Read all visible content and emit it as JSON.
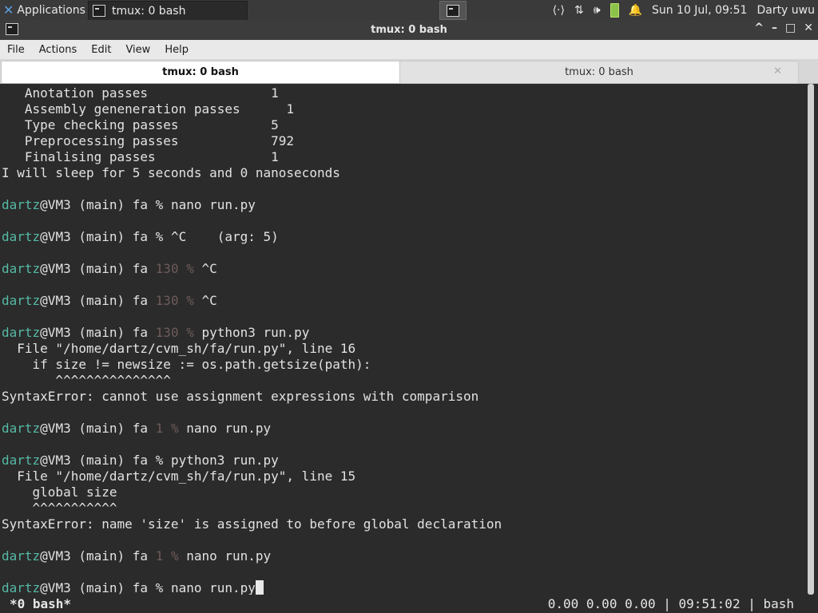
{
  "panel": {
    "applications_label": "Applications",
    "task_label": "tmux: 0 bash",
    "clock": "Sun 10 Jul, 09:51",
    "user": "Darty uwu"
  },
  "window": {
    "title": "tmux: 0 bash",
    "buttons": [
      "^",
      "–",
      "□",
      "✕"
    ]
  },
  "menu": [
    "File",
    "Actions",
    "Edit",
    "View",
    "Help"
  ],
  "tabs": [
    {
      "label": "tmux: 0 bash",
      "active": true
    },
    {
      "label": "tmux: 0 bash",
      "active": false
    }
  ],
  "terminal": {
    "lines": [
      {
        "text": "   Anotation passes                1"
      },
      {
        "text": "   Assembly geneneration passes      1"
      },
      {
        "text": "   Type checking passes            5"
      },
      {
        "text": "   Preprocessing passes            792"
      },
      {
        "text": "   Finalising passes               1"
      },
      {
        "text": "I will sleep for 5 seconds and 0 nanoseconds"
      },
      {
        "text": ""
      },
      {
        "prompt": {
          "user": "dartz",
          "host": "@VM3 (main) fa ",
          "status": "",
          "sym": "% "
        },
        "cmd": "nano run.py"
      },
      {
        "text": ""
      },
      {
        "prompt": {
          "user": "dartz",
          "host": "@VM3 (main) fa ",
          "status": "",
          "sym": "% "
        },
        "cmd": "^C    (arg: 5)"
      },
      {
        "text": ""
      },
      {
        "prompt": {
          "user": "dartz",
          "host": "@VM3 (main) fa ",
          "status": "130 ",
          "sym": "% "
        },
        "cmd": "^C"
      },
      {
        "text": ""
      },
      {
        "prompt": {
          "user": "dartz",
          "host": "@VM3 (main) fa ",
          "status": "130 ",
          "sym": "% "
        },
        "cmd": "^C"
      },
      {
        "text": ""
      },
      {
        "prompt": {
          "user": "dartz",
          "host": "@VM3 (main) fa ",
          "status": "130 ",
          "sym": "% "
        },
        "cmd": "python3 run.py"
      },
      {
        "text": "  File \"/home/dartz/cvm_sh/fa/run.py\", line 16"
      },
      {
        "text": "    if size != newsize := os.path.getsize(path):"
      },
      {
        "text": "       ^^^^^^^^^^^^^^^"
      },
      {
        "text": "SyntaxError: cannot use assignment expressions with comparison"
      },
      {
        "text": ""
      },
      {
        "prompt": {
          "user": "dartz",
          "host": "@VM3 (main) fa ",
          "status": "1 ",
          "sym": "% "
        },
        "cmd": "nano run.py"
      },
      {
        "text": ""
      },
      {
        "prompt": {
          "user": "dartz",
          "host": "@VM3 (main) fa ",
          "status": "",
          "sym": "% "
        },
        "cmd": "python3 run.py"
      },
      {
        "text": "  File \"/home/dartz/cvm_sh/fa/run.py\", line 15"
      },
      {
        "text": "    global size"
      },
      {
        "text": "    ^^^^^^^^^^^"
      },
      {
        "text": "SyntaxError: name 'size' is assigned to before global declaration"
      },
      {
        "text": ""
      },
      {
        "prompt": {
          "user": "dartz",
          "host": "@VM3 (main) fa ",
          "status": "1 ",
          "sym": "% "
        },
        "cmd": "nano run.py"
      },
      {
        "text": ""
      },
      {
        "prompt": {
          "user": "dartz",
          "host": "@VM3 (main) fa ",
          "status": "",
          "sym": "% "
        },
        "cmd": "nano run.py",
        "cursor": true
      }
    ]
  },
  "tmux_status": {
    "left": "*0 bash*",
    "right": "0.00 0.00 0.00 | 09:51:02 | bash"
  }
}
